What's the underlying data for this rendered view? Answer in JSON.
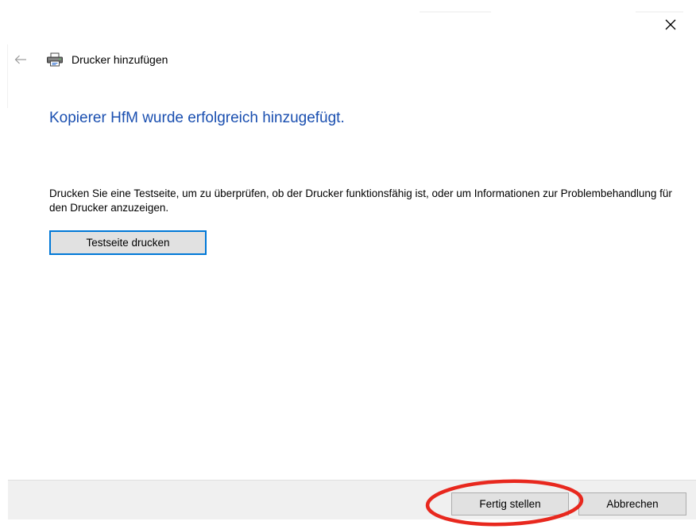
{
  "window": {
    "close_icon": "close-icon"
  },
  "header": {
    "back_icon": "arrow-left-icon",
    "wizard_icon": "printer-icon",
    "title": "Drucker hinzufügen"
  },
  "main": {
    "headline": "Kopierer HfM wurde erfolgreich hinzugefügt.",
    "description": "Drucken Sie eine Testseite, um zu überprüfen, ob der Drucker funktionsfähig ist, oder um Informationen zur Problembehandlung für den Drucker anzuzeigen.",
    "test_page_button": "Testseite drucken"
  },
  "footer": {
    "finish_button": "Fertig stellen",
    "cancel_button": "Abbrechen"
  },
  "annotation": {
    "type": "ellipse",
    "target": "finish_button",
    "color": "#e8281e"
  },
  "colors": {
    "headline": "#1a4fb0",
    "focus_border": "#0078d7",
    "button_bg": "#e1e1e1",
    "footer_bg": "#f0f0f0"
  }
}
